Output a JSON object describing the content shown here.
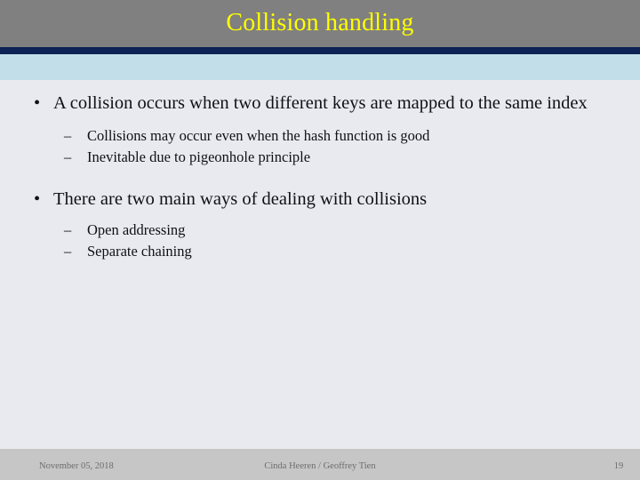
{
  "slide": {
    "title": "Collision handling",
    "colors": {
      "header_bg": "#808080",
      "title_text": "#ffff00",
      "accent_stripe": "#0d2255",
      "sub_band": "#c2dfe9",
      "body_bg": "#e9eaef",
      "body_text": "#101018",
      "footer_bg": "#c6c6c6",
      "footer_text": "#6d6d6d"
    },
    "bullets": [
      {
        "marker": "•",
        "text": "A collision occurs when two different keys are mapped to the same index",
        "sub_marker": "–",
        "sub_items": [
          "Collisions may occur even when the hash function is good",
          "Inevitable due to pigeonhole principle"
        ]
      },
      {
        "marker": "•",
        "text": "There are two main ways of dealing with collisions",
        "sub_marker": "–",
        "sub_items": [
          "Open addressing",
          "Separate chaining"
        ]
      }
    ],
    "footer": {
      "date": "November 05, 2018",
      "authors": "Cinda Heeren / Geoffrey Tien",
      "page_number": "19"
    }
  }
}
